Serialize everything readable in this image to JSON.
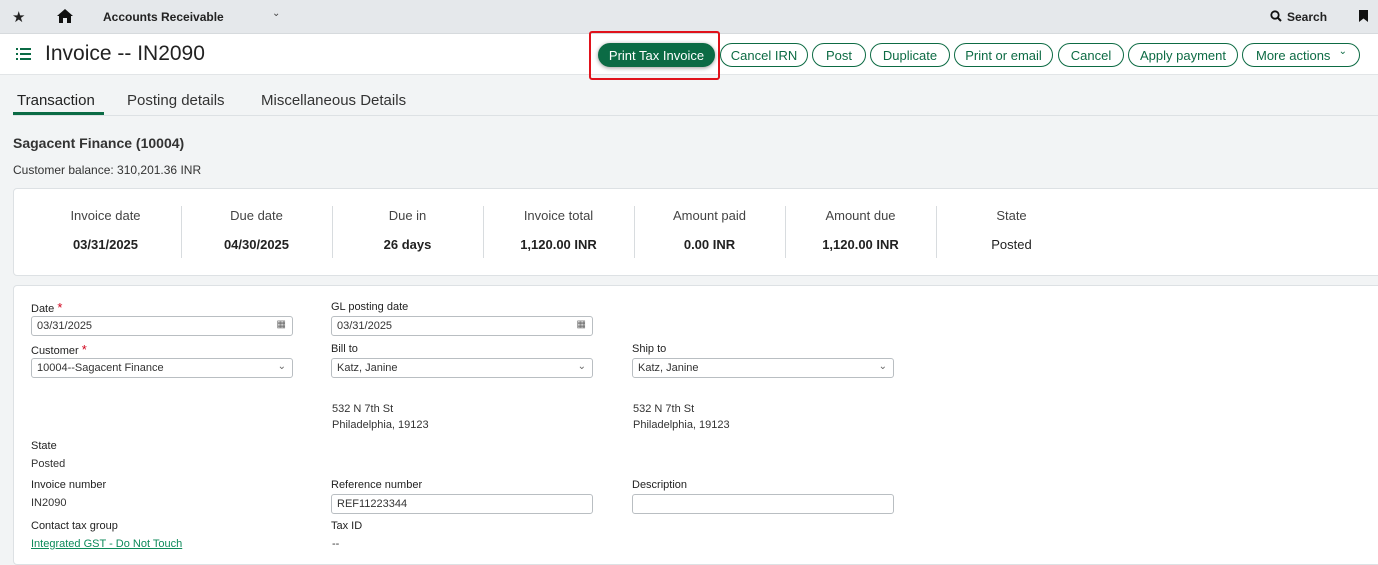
{
  "topbar": {
    "app": "Accounts Receivable",
    "search": "Search"
  },
  "header": {
    "title": "Invoice -- IN2090",
    "buttons": [
      "Print Tax Invoice",
      "Cancel IRN",
      "Post",
      "Duplicate",
      "Print or email",
      "Cancel",
      "Apply payment",
      "More actions"
    ]
  },
  "tabs": [
    "Transaction",
    "Posting details",
    "Miscellaneous Details"
  ],
  "customer": {
    "name": "Sagacent Finance (10004)",
    "balance": "Customer balance: 310,201.36 INR"
  },
  "summary": [
    {
      "label": "Invoice date",
      "value": "03/31/2025"
    },
    {
      "label": "Due date",
      "value": "04/30/2025"
    },
    {
      "label": "Due in",
      "value": "26 days"
    },
    {
      "label": "Invoice total",
      "value": "1,120.00 INR"
    },
    {
      "label": "Amount paid",
      "value": "0.00 INR"
    },
    {
      "label": "Amount due",
      "value": "1,120.00 INR"
    },
    {
      "label": "State",
      "value": "Posted"
    }
  ],
  "form": {
    "date_label": "Date",
    "date": "03/31/2025",
    "required": "*",
    "gl_label": "GL posting date",
    "gl_date": "03/31/2025",
    "customer_label": "Customer",
    "customer": "10004--Sagacent Finance",
    "billto_label": "Bill to",
    "billto": "Katz, Janine",
    "shipto_label": "Ship to",
    "shipto": "Katz, Janine",
    "bill_addr1": "532 N 7th St",
    "bill_addr2": "Philadelphia, 19123",
    "ship_addr1": "532 N 7th St",
    "ship_addr2": "Philadelphia, 19123",
    "state_label": "State",
    "state": "Posted",
    "invno_label": "Invoice number",
    "invno": "IN2090",
    "ref_label": "Reference number",
    "ref": "REF11223344",
    "desc_label": "Description",
    "desc": "",
    "taxgroup_label": "Contact tax group",
    "taxgroup": "Integrated GST - Do Not Touch",
    "taxid_label": "Tax ID",
    "taxid": "--"
  },
  "colors": {
    "accent": "#0b6b45",
    "highlight": "#e0121b"
  }
}
